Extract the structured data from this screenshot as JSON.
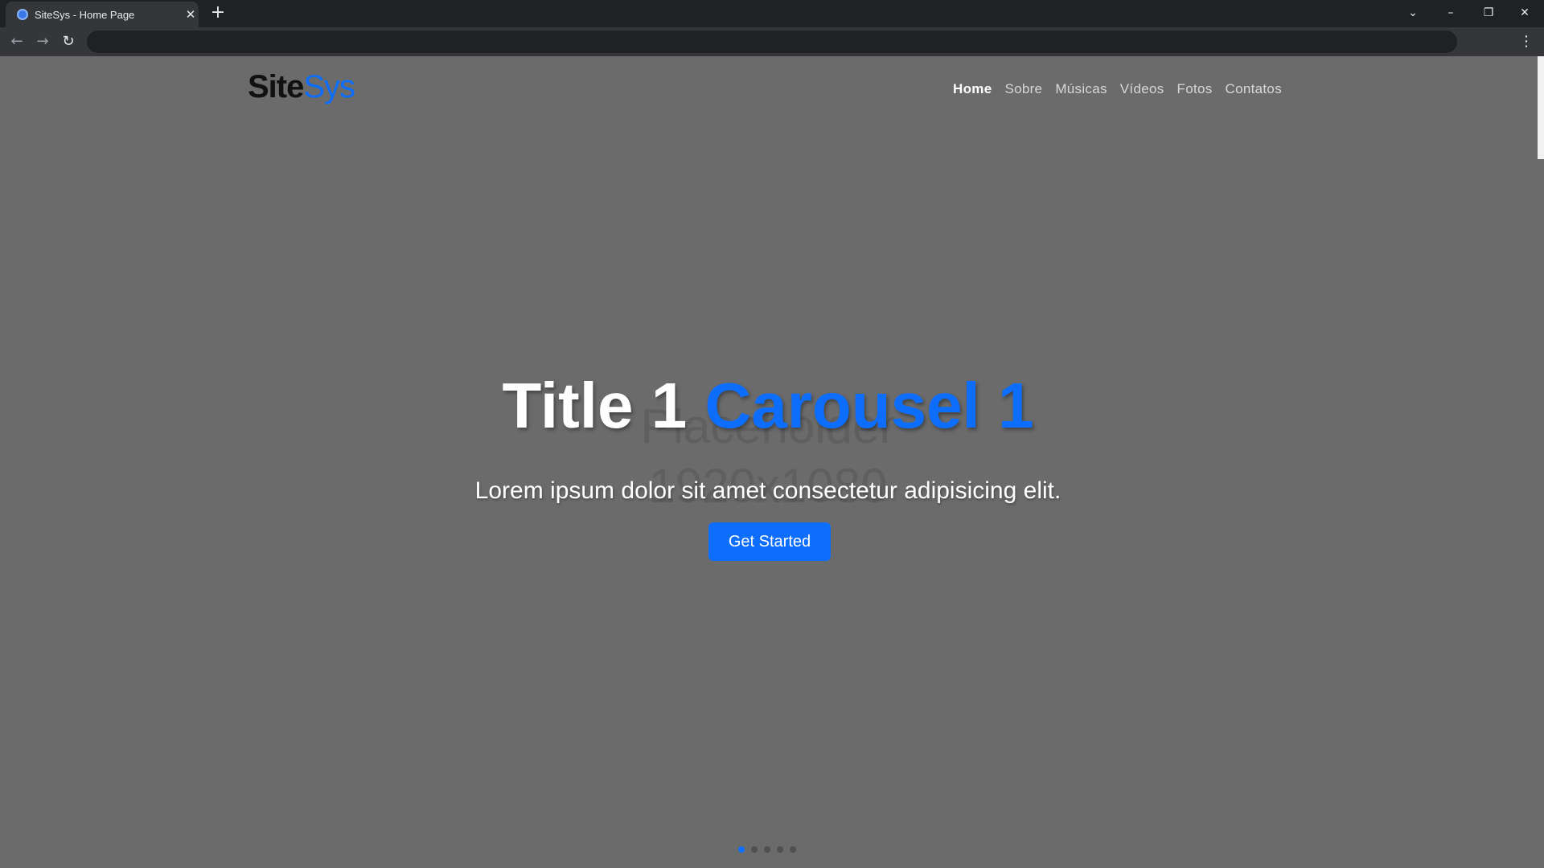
{
  "browser": {
    "tab_title": "SiteSys - Home Page",
    "close_glyph": "✕",
    "new_tab_glyph": "+",
    "back_glyph": "←",
    "forward_glyph": "→",
    "reload_glyph": "↻",
    "menu_glyph": "⋮",
    "controls": {
      "tab_list_glyph": "⌄",
      "minimize_glyph": "–",
      "restore_glyph": "❐",
      "close_glyph": "✕"
    },
    "address_value": ""
  },
  "site": {
    "brand_part1": "Site",
    "brand_part2": "Sys",
    "nav": [
      {
        "label": "Home"
      },
      {
        "label": "Sobre"
      },
      {
        "label": "Músicas"
      },
      {
        "label": "Vídeos"
      },
      {
        "label": "Fotos"
      },
      {
        "label": "Contatos"
      }
    ],
    "active_nav": "Home"
  },
  "hero": {
    "placeholder_line1": "Placeholder",
    "placeholder_line2": "1920x1080",
    "title_part1": "Title 1 ",
    "title_part2": "Carousel 1",
    "subtitle": "Lorem ipsum dolor sit amet consectetur adipisicing elit.",
    "cta_label": "Get Started"
  },
  "carousel": {
    "slide_count": 5,
    "active_index": 0
  },
  "colors": {
    "accent": "#0d6efd",
    "page_bg": "#6b6b6b"
  }
}
